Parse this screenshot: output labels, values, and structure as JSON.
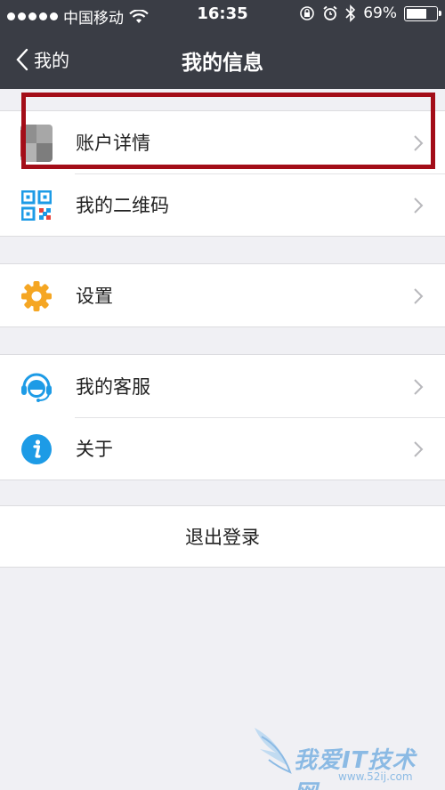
{
  "status_bar": {
    "carrier": "中国移动",
    "time": "16:35",
    "battery": "69%",
    "battery_level": 0.69
  },
  "nav": {
    "back_label": "我的",
    "title": "我的信息"
  },
  "groups": [
    {
      "items": [
        {
          "label": "账户详情",
          "icon": "avatar-icon"
        },
        {
          "label": "我的二维码",
          "icon": "qr-code-icon"
        }
      ]
    },
    {
      "items": [
        {
          "label": "设置",
          "icon": "gear-icon"
        }
      ]
    },
    {
      "items": [
        {
          "label": "我的客服",
          "icon": "customer-service-icon"
        },
        {
          "label": "关于",
          "icon": "info-icon"
        }
      ]
    }
  ],
  "logout_label": "退出登录",
  "watermark": {
    "text": "我爱IT技术网",
    "url": "www.52ij.com"
  },
  "colors": {
    "nav_background": "#3a3d45",
    "highlight_border": "#a30d18",
    "gear": "#f5a623",
    "blue_icons": "#1d9be6",
    "page_background": "#f0f0f4"
  }
}
